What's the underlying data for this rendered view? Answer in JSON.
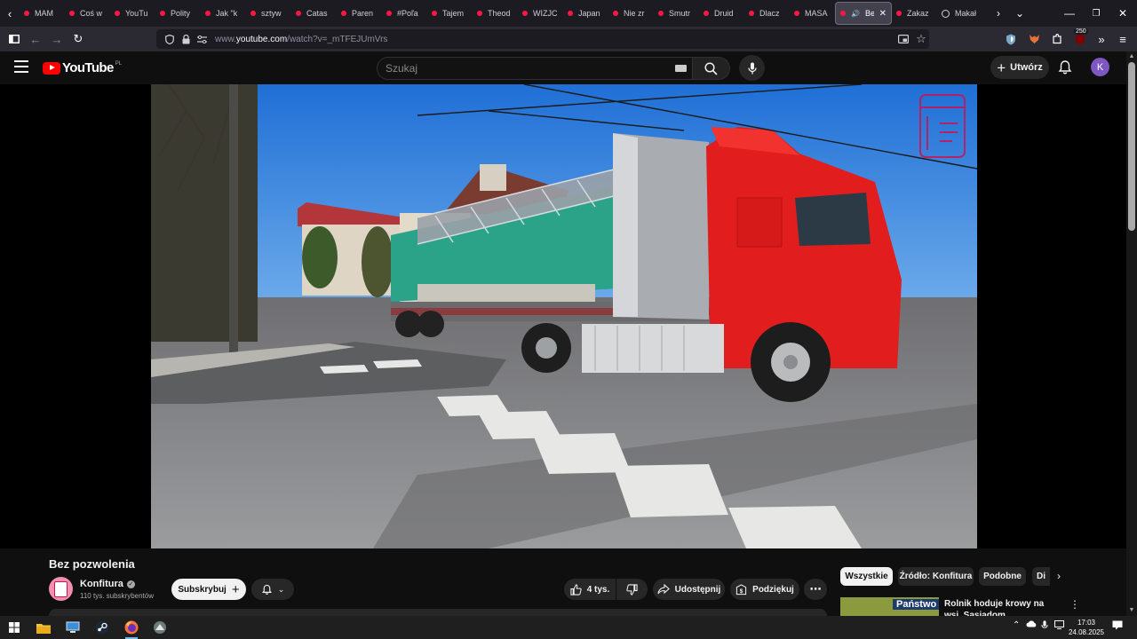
{
  "browser": {
    "tabs": [
      {
        "label": "MAM",
        "favicon": "youtube-icon"
      },
      {
        "label": "Coś w",
        "favicon": "youtube-icon"
      },
      {
        "label": "YouTu",
        "favicon": "youtube-icon"
      },
      {
        "label": "Polity",
        "favicon": "youtube-icon"
      },
      {
        "label": "Jak \"k",
        "favicon": "youtube-icon"
      },
      {
        "label": "sztyw",
        "favicon": "youtube-icon"
      },
      {
        "label": "Catas",
        "favicon": "youtube-icon"
      },
      {
        "label": "Paren",
        "favicon": "youtube-icon"
      },
      {
        "label": "#Poľa",
        "favicon": "youtube-icon"
      },
      {
        "label": "Tajem",
        "favicon": "youtube-icon"
      },
      {
        "label": "Theod",
        "favicon": "youtube-icon"
      },
      {
        "label": "WIZJC",
        "favicon": "youtube-icon"
      },
      {
        "label": "Japan",
        "favicon": "youtube-icon"
      },
      {
        "label": "Nie zr",
        "favicon": "youtube-icon"
      },
      {
        "label": "Smutr",
        "favicon": "youtube-icon"
      },
      {
        "label": "Druid",
        "favicon": "youtube-icon"
      },
      {
        "label": "Dlacz",
        "favicon": "youtube-icon"
      },
      {
        "label": "MASA",
        "favicon": "youtube-icon"
      },
      {
        "label": "Bez",
        "favicon": "youtube-icon",
        "active": true,
        "audio": true
      },
      {
        "label": "Zakaz",
        "favicon": "youtube-icon"
      },
      {
        "label": "Makał",
        "favicon": "circle-play-icon"
      }
    ],
    "url_prefix": "www.",
    "url_host": "youtube.com",
    "url_path": "/watch?v=_mTFEJUmVrs",
    "extension_badge": "250"
  },
  "youtube": {
    "logo_text": "YouTube",
    "country_code": "PL",
    "search_placeholder": "Szukaj",
    "create_label": "Utwórz",
    "avatar_letter": "K"
  },
  "video": {
    "title": "Bez pozwolenia",
    "channel": "Konfitura",
    "subscribers": "110 tys. subskrybentów",
    "subscribe_label": "Subskrybuj",
    "likes": "4 tys.",
    "share_label": "Udostępnij",
    "thanks_label": "Podziękuj"
  },
  "chips": [
    "Wszystkie",
    "Źródło: Konfitura",
    "Podobne",
    "Di"
  ],
  "recommendation": {
    "thumb_label": "Państwo",
    "title": "Rolnik hoduje krowy na wsi. Sąsiadom przeszkadza zapach"
  },
  "taskbar": {
    "time": "17:03",
    "date": "24.08.2025"
  },
  "colors": {
    "yt_red": "#ff0000",
    "bg": "#0f0f0f",
    "avatar": "#7e57c2",
    "browser_bg": "#1c1b22"
  }
}
